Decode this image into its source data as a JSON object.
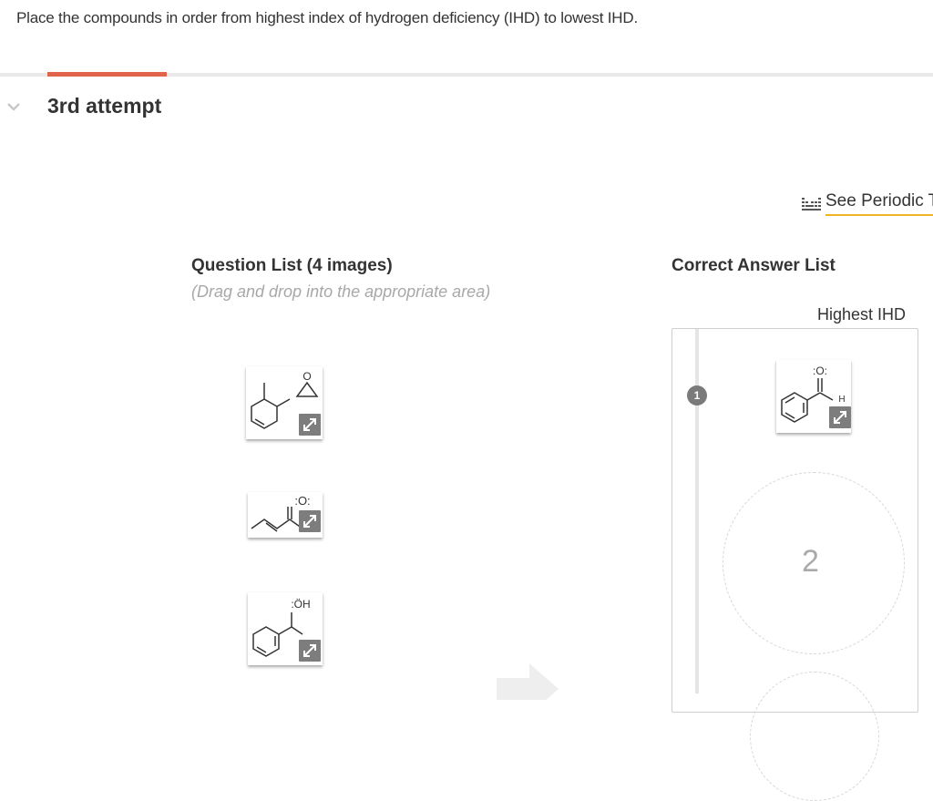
{
  "question": "Place the compounds in order from highest index of hydrogen deficiency (IHD) to lowest IHD.",
  "attempt_label": "3rd attempt",
  "periodic_table_link": "See Periodic T",
  "question_list": {
    "title": "Question List (4 images)",
    "hint": "(Drag and drop into the appropriate area)"
  },
  "answer_list": {
    "title": "Correct Answer List",
    "highest_label": "Highest IHD",
    "slots": [
      "1",
      "2"
    ]
  },
  "structure_labels": {
    "epoxide_oxygen": "O",
    "ketone_oxygen": ":O:",
    "alcohol_oh": ":ÖH",
    "aldehyde_oxygen": ":O:",
    "aldehyde_h": "H"
  },
  "colors": {
    "accent_tab": "#e0634a",
    "link_underline": "#f0b323",
    "badge": "#7a7a7a"
  },
  "icons": [
    "chevron-down-icon",
    "periodic-table-icon",
    "expand-icon"
  ]
}
